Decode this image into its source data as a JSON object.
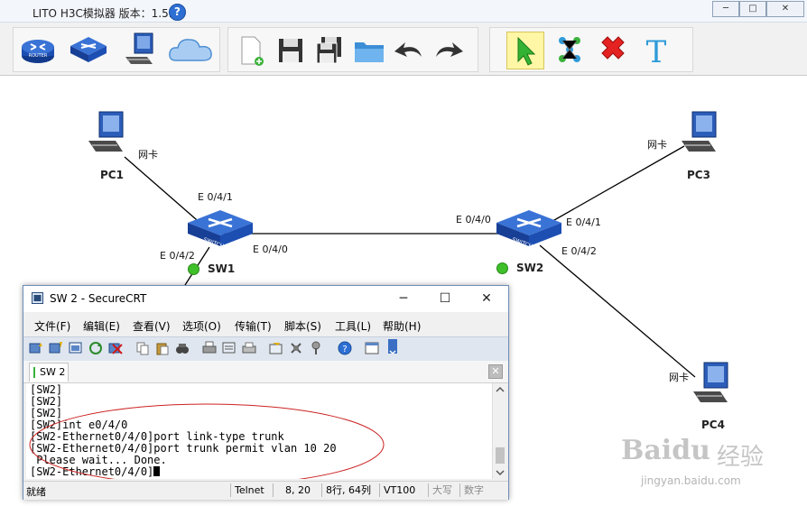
{
  "app": {
    "title": "LITO H3C模拟器 版本：1.5.2",
    "help_glyph": "?"
  },
  "toolbar": {
    "device_buttons": [
      "router-tool",
      "switch-tool",
      "pc-tool",
      "cloud-tool"
    ],
    "file_buttons": [
      "new-file",
      "save",
      "save-as",
      "open-folder",
      "undo",
      "redo"
    ],
    "edit_buttons": [
      "select-pointer",
      "connect-tool",
      "delete-tool",
      "text-tool"
    ],
    "text_tool_glyph": "T"
  },
  "topology": {
    "nodes": {
      "pc1": "PC1",
      "pc3": "PC3",
      "pc4": "PC4",
      "sw1": "SW1",
      "sw2": "SW2"
    },
    "ports": {
      "sw1_e041": "E 0/4/1",
      "sw1_e042": "E 0/4/2",
      "sw1_e040": "E 0/4/0",
      "sw2_e040": "E 0/4/0",
      "sw2_e041": "E 0/4/1",
      "sw2_e042": "E 0/4/2"
    },
    "nic_label": "网卡",
    "router_icon_text": "ROUTER",
    "switch_icon_text": "SWITCH",
    "status_color": "#3fbf2a"
  },
  "securecrt": {
    "title": "SW 2 - SecureCRT",
    "menus": [
      "文件(F)",
      "编辑(E)",
      "查看(V)",
      "选项(O)",
      "传输(T)",
      "脚本(S)",
      "工具(L)",
      "帮助(H)"
    ],
    "session_tab": "SW 2",
    "terminal_lines": [
      "[SW2]",
      "[SW2]",
      "[SW2]",
      "[SW2]int e0/4/0",
      "[SW2-Ethernet0/4/0]port link-type trunk",
      "[SW2-Ethernet0/4/0]port trunk permit vlan 10 20",
      " Please wait... Done.",
      "[SW2-Ethernet0/4/0]"
    ],
    "status": {
      "state": "就绪",
      "protocol": "Telnet",
      "cursor_pos": "8,  20",
      "rows_cols": "8行, 64列",
      "terminal_type": "VT100",
      "caps": "大写",
      "num": "数字"
    }
  },
  "watermark": {
    "brand": "Baidu",
    "brand_cn": "经验",
    "url": "jingyan.baidu.com"
  }
}
